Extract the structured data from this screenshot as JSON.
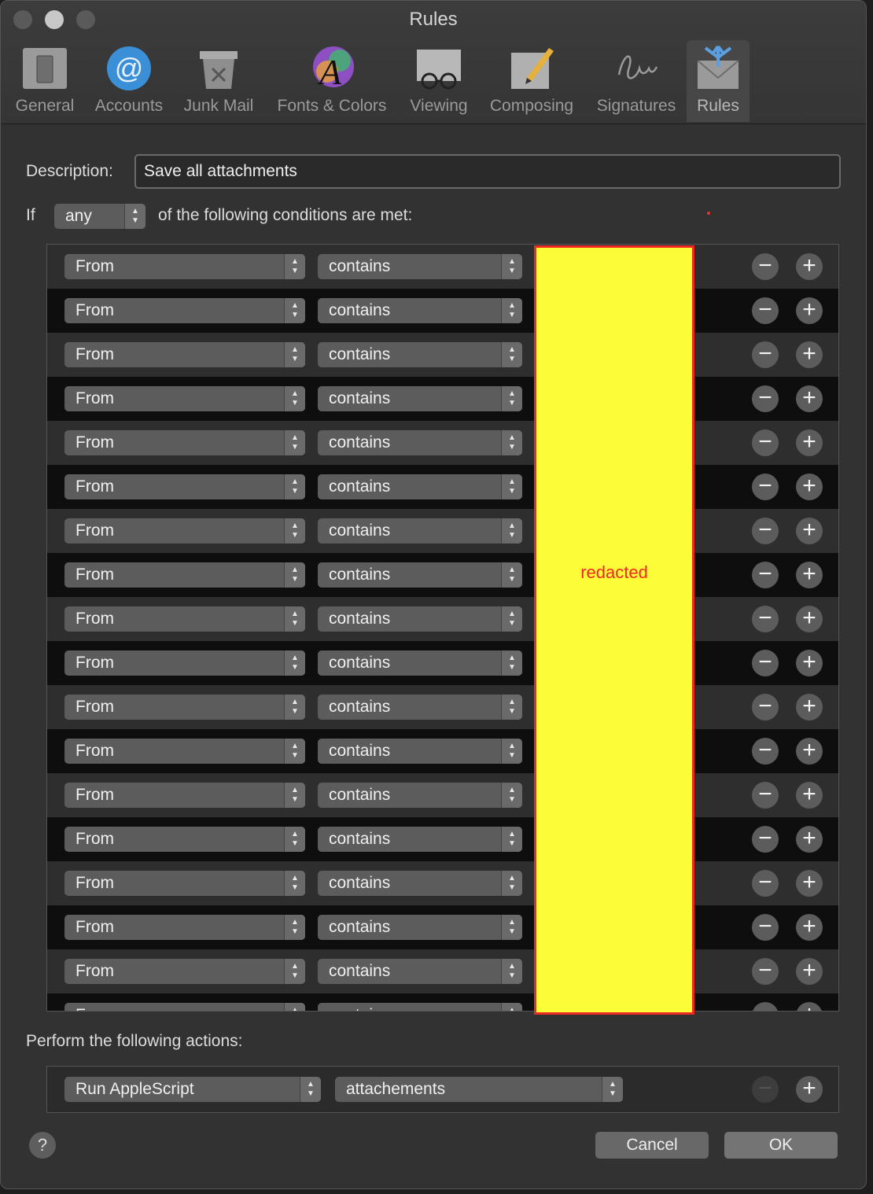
{
  "window": {
    "title": "Rules"
  },
  "toolbar": {
    "items": [
      {
        "label": "General",
        "icon": "general-icon"
      },
      {
        "label": "Accounts",
        "icon": "at-sign-icon"
      },
      {
        "label": "Junk Mail",
        "icon": "trash-icon"
      },
      {
        "label": "Fonts & Colors",
        "icon": "fonts-colors-icon"
      },
      {
        "label": "Viewing",
        "icon": "glasses-icon"
      },
      {
        "label": "Composing",
        "icon": "pencil-icon"
      },
      {
        "label": "Signatures",
        "icon": "signature-icon"
      },
      {
        "label": "Rules",
        "icon": "rules-envelope-icon"
      }
    ],
    "active": "Rules"
  },
  "form": {
    "description_label": "Description:",
    "description_value": "Save all attachments",
    "if_label": "If",
    "match_value": "any",
    "conditions_suffix": "of the following conditions are met:",
    "condition_field": "From",
    "condition_operator": "contains",
    "condition_count": 18,
    "redacted_label": "redacted",
    "actions_label": "Perform the following actions:",
    "action_type": "Run AppleScript",
    "action_script": "attachements"
  },
  "buttons": {
    "cancel": "Cancel",
    "ok": "OK",
    "help": "?"
  },
  "colors": {
    "redact_fill": "#fdfc38",
    "redact_border": "#ee2a24"
  }
}
